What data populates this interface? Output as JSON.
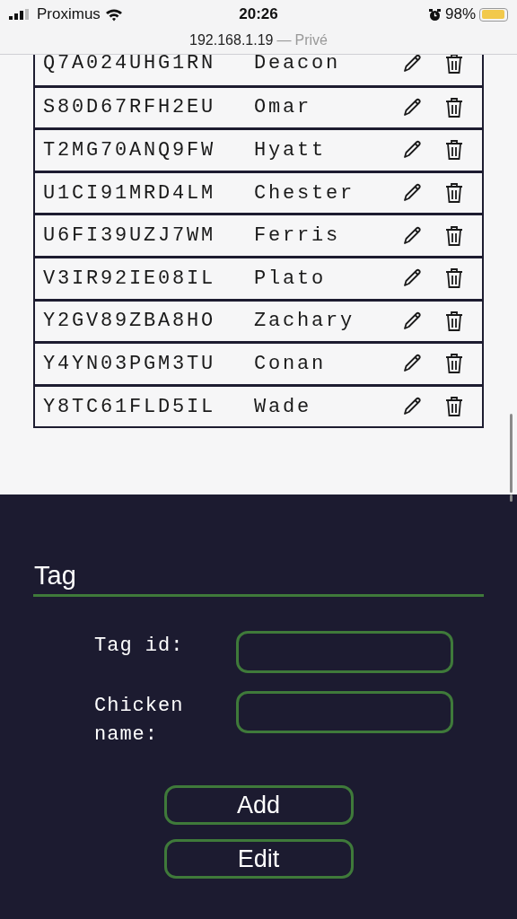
{
  "status_bar": {
    "carrier": "Proximus",
    "time": "20:26",
    "battery": "98%"
  },
  "address_bar": {
    "host": "192.168.1.19",
    "separator": "—",
    "mode": "Privé"
  },
  "table": {
    "rows": [
      {
        "tag_id": "Q7A024UHG1RN",
        "name": "Deacon"
      },
      {
        "tag_id": "S80D67RFH2EU",
        "name": "Omar"
      },
      {
        "tag_id": "T2MG70ANQ9FW",
        "name": "Hyatt"
      },
      {
        "tag_id": "U1CI91MRD4LM",
        "name": "Chester"
      },
      {
        "tag_id": "U6FI39UZJ7WM",
        "name": "Ferris"
      },
      {
        "tag_id": "V3IR92IE08IL",
        "name": "Plato"
      },
      {
        "tag_id": "Y2GV89ZBA8HO",
        "name": "Zachary"
      },
      {
        "tag_id": "Y4YN03PGM3TU",
        "name": "Conan"
      },
      {
        "tag_id": "Y8TC61FLD5IL",
        "name": "Wade"
      }
    ]
  },
  "form": {
    "title": "Tag",
    "fields": [
      {
        "label": "Tag id:"
      },
      {
        "label": "Chicken name:"
      }
    ],
    "buttons": [
      "Add",
      "Edit"
    ]
  }
}
